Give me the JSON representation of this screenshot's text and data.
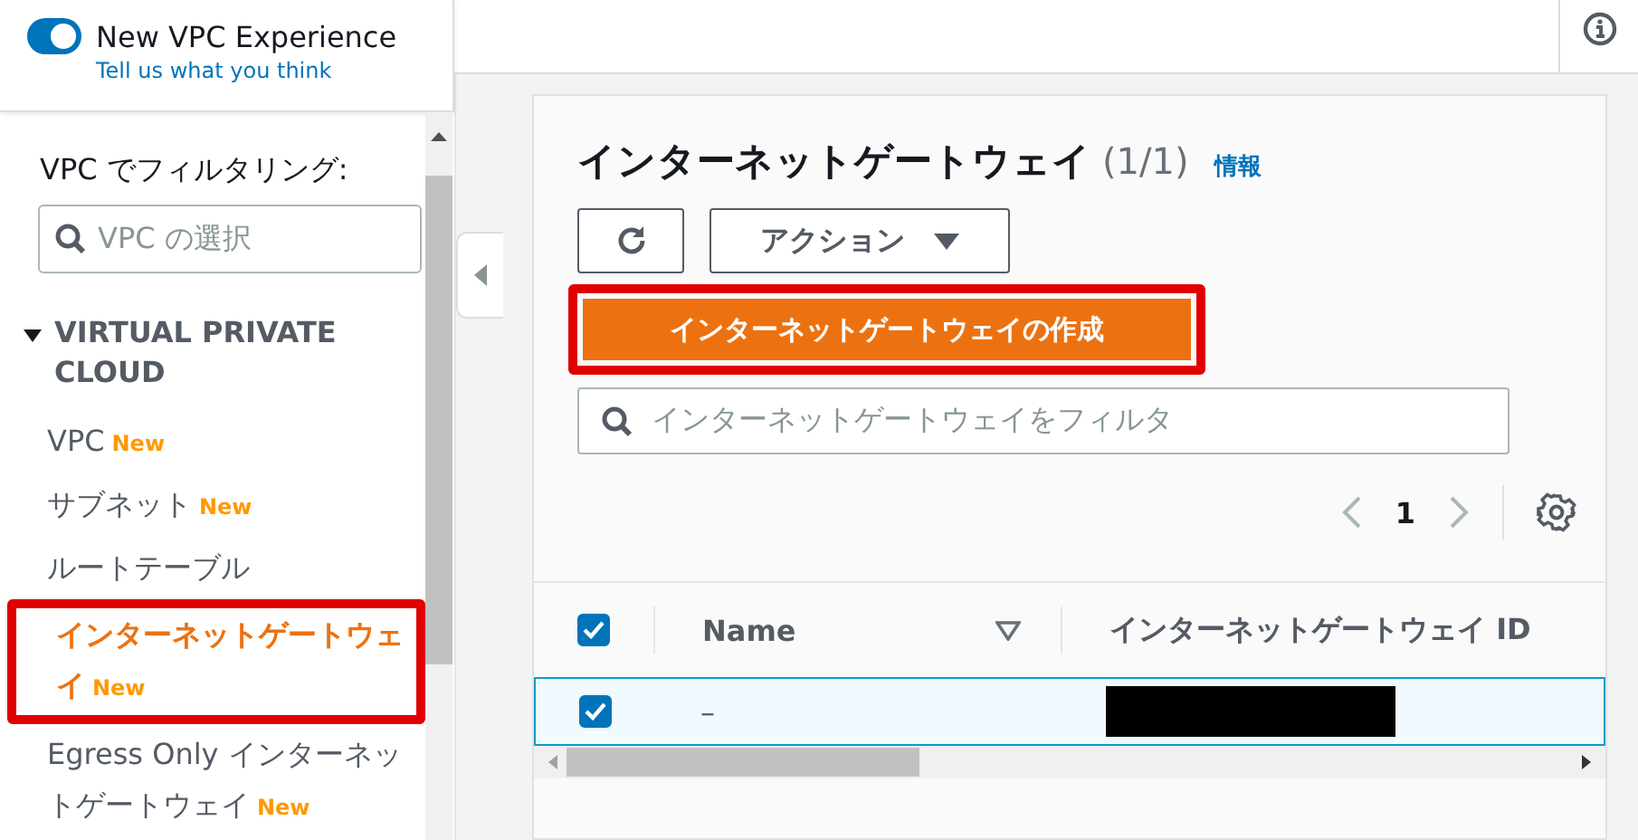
{
  "experience": {
    "label": "New VPC Experience",
    "on": true,
    "link": "Tell us what you think"
  },
  "filter": {
    "label": "VPC でフィルタリング:",
    "placeholder": "VPC の選択"
  },
  "nav": {
    "section": {
      "title": "VIRTUAL PRIVATE CLOUD",
      "expanded": true
    },
    "items": [
      {
        "label": "VPC",
        "badge": "New",
        "selected": false,
        "highlighted": false
      },
      {
        "label": "サブネット",
        "badge": "New",
        "selected": false,
        "highlighted": false
      },
      {
        "label": "ルートテーブル",
        "selected": false,
        "highlighted": false
      },
      {
        "label": "インターネットゲートウェイ",
        "badge": "New",
        "selected": true,
        "highlighted": true
      },
      {
        "label": "Egress Only インターネットゲートウェイ",
        "badge": "New",
        "selected": false,
        "highlighted": false
      }
    ]
  },
  "panel": {
    "title": "インターネットゲートウェイ",
    "count": "(1/1)",
    "info_link": "情報",
    "actions_label": "アクション",
    "create_button": {
      "label": "インターネットゲートウェイの作成",
      "highlighted": true
    },
    "search": {
      "placeholder": "インターネットゲートウェイをフィルタ"
    },
    "pagination": {
      "page": "1"
    },
    "table": {
      "select_all": true,
      "columns": [
        "Name",
        "インターネットゲートウェイ ID"
      ],
      "rows": [
        {
          "selected": true,
          "name": "–"
        }
      ]
    }
  }
}
